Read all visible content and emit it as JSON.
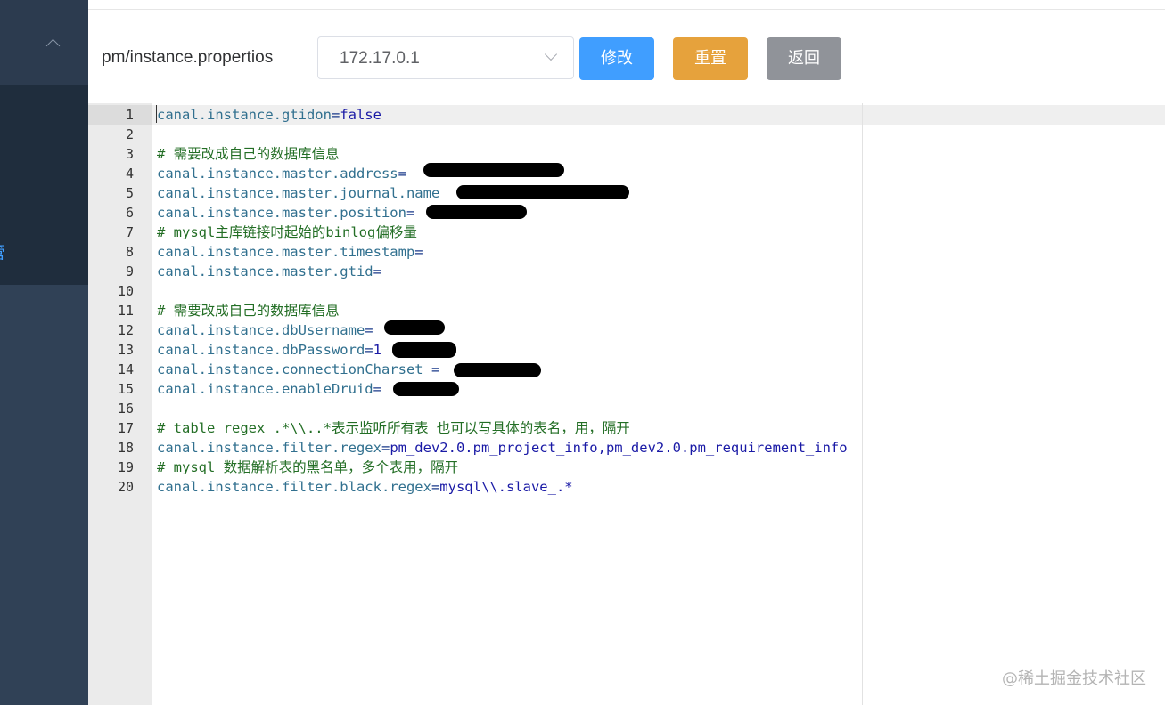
{
  "sidebar": {
    "active_item_label": "管理"
  },
  "header": {
    "file_title": "pm/instance.propertios",
    "host_select": {
      "value": "172.17.0.1"
    },
    "buttons": {
      "edit": "修改",
      "reset": "重置",
      "back": "返回"
    }
  },
  "editor": {
    "line_numbers": [
      "1",
      "2",
      "3",
      "4",
      "5",
      "6",
      "7",
      "8",
      "9",
      "10",
      "11",
      "12",
      "13",
      "14",
      "15",
      "16",
      "17",
      "18",
      "19",
      "20"
    ],
    "lines": [
      {
        "key": "canal.instance.gtidon",
        "eq": "=",
        "val": "false"
      },
      {
        "key": "",
        "eq": "",
        "val": ""
      },
      {
        "comment": "# 需要改成自己的数据库信息"
      },
      {
        "key": "canal.instance.master.address",
        "eq": "=",
        "val": ""
      },
      {
        "key": "canal.instance.master.journal.name",
        "eq": "",
        "val": ""
      },
      {
        "key": "canal.instance.master.position",
        "eq": "=",
        "val": ""
      },
      {
        "comment": "# mysql主库链接时起始的binlog偏移量"
      },
      {
        "key": "canal.instance.master.timestamp",
        "eq": "=",
        "val": ""
      },
      {
        "key": "canal.instance.master.gtid",
        "eq": "=",
        "val": ""
      },
      {
        "key": "",
        "eq": "",
        "val": ""
      },
      {
        "comment": "# 需要改成自己的数据库信息"
      },
      {
        "key": "canal.instance.dbUsername",
        "eq": "=",
        "val": ""
      },
      {
        "key": "canal.instance.dbPassword",
        "eq": "=",
        "val": "1"
      },
      {
        "key": "canal.instance.connectionCharset",
        "eq": " =",
        "val": ""
      },
      {
        "key": "canal.instance.enableDruid",
        "eq": "=",
        "val": ""
      },
      {
        "key": "",
        "eq": "",
        "val": ""
      },
      {
        "comment": "# table regex .*\\\\..*表示监听所有表 也可以写具体的表名，用，隔开"
      },
      {
        "key": "canal.instance.filter.regex",
        "eq": "=",
        "val": "pm_dev2.0.pm_project_info,pm_dev2.0.pm_requirement_info"
      },
      {
        "comment": "# mysql 数据解析表的黑名单，多个表用，隔开"
      },
      {
        "key": "canal.instance.filter.black.regex",
        "eq": "=",
        "val": "mysql\\\\.slave_.*"
      }
    ]
  },
  "watermark": "@稀土掘金技术社区"
}
